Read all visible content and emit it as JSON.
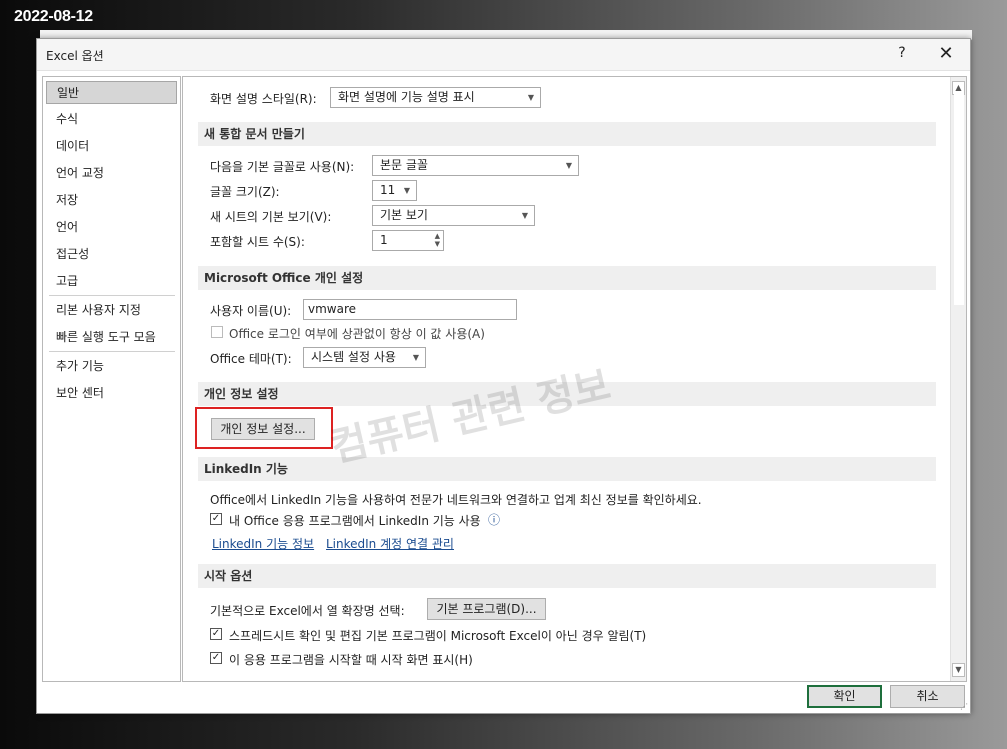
{
  "stamp": "2022-08-12",
  "watermark": "컴퓨터 관련 정보",
  "dialog": {
    "title": "Excel 옵션",
    "help": "?",
    "close": "✕"
  },
  "nav": {
    "items": [
      {
        "label": "일반",
        "selected": true
      },
      {
        "label": "수식"
      },
      {
        "label": "데이터"
      },
      {
        "label": "언어 교정"
      },
      {
        "label": "저장"
      },
      {
        "label": "언어"
      },
      {
        "label": "접근성"
      },
      {
        "label": "고급"
      },
      {
        "label": "리본 사용자 지정"
      },
      {
        "label": "빠른 실행 도구 모음"
      },
      {
        "label": "추가 기능"
      },
      {
        "label": "보안 센터"
      }
    ]
  },
  "ui": {
    "screentip_label": "화면 설명 스타일(R):",
    "screentip_value": "화면 설명에 기능 설명 표시"
  },
  "new_workbook": {
    "header": "새 통합 문서 만들기",
    "font_label": "다음을 기본 글꼴로 사용(N):",
    "font_value": "본문 글꼴",
    "size_label": "글꼴 크기(Z):",
    "size_value": "11",
    "view_label": "새 시트의 기본 보기(V):",
    "view_value": "기본 보기",
    "sheets_label": "포함할 시트 수(S):",
    "sheets_value": "1"
  },
  "personalize": {
    "header": "Microsoft Office 개인 설정",
    "username_label": "사용자 이름(U):",
    "username_value": "vmware",
    "always_use_label": "Office 로그인 여부에 상관없이 항상 이 값 사용(A)",
    "theme_label": "Office 테마(T):",
    "theme_value": "시스템 설정 사용"
  },
  "privacy": {
    "header": "개인 정보 설정",
    "button": "개인 정보 설정..."
  },
  "linkedin": {
    "header": "LinkedIn 기능",
    "description": "Office에서 LinkedIn 기능을 사용하여 전문가 네트워크와 연결하고 업계 최신 정보를 확인하세요.",
    "enable_label": "내 Office 응용 프로그램에서 LinkedIn 기능 사용",
    "info_icon": "ⓘ",
    "link_about": "LinkedIn 기능 정보",
    "link_manage": "LinkedIn 계정 연결 관리"
  },
  "startup": {
    "header": "시작 옵션",
    "ext_label": "기본적으로 Excel에서 열 확장명 선택:",
    "default_programs": "기본 프로그램(D)...",
    "tell_me_label": "스프레드시트 확인 및 편집 기본 프로그램이 Microsoft Excel이 아닌 경우 알림(T)",
    "show_start_label": "이 응용 프로그램을 시작할 때 시작 화면 표시(H)"
  },
  "footer": {
    "ok": "확인",
    "cancel": "취소"
  },
  "icons": {
    "check": "✓",
    "dropdown": "▼",
    "scroll_up": "▲",
    "scroll_down": "▼",
    "spin_up": "▲",
    "spin_down": "▼",
    "grip": "⋰"
  }
}
